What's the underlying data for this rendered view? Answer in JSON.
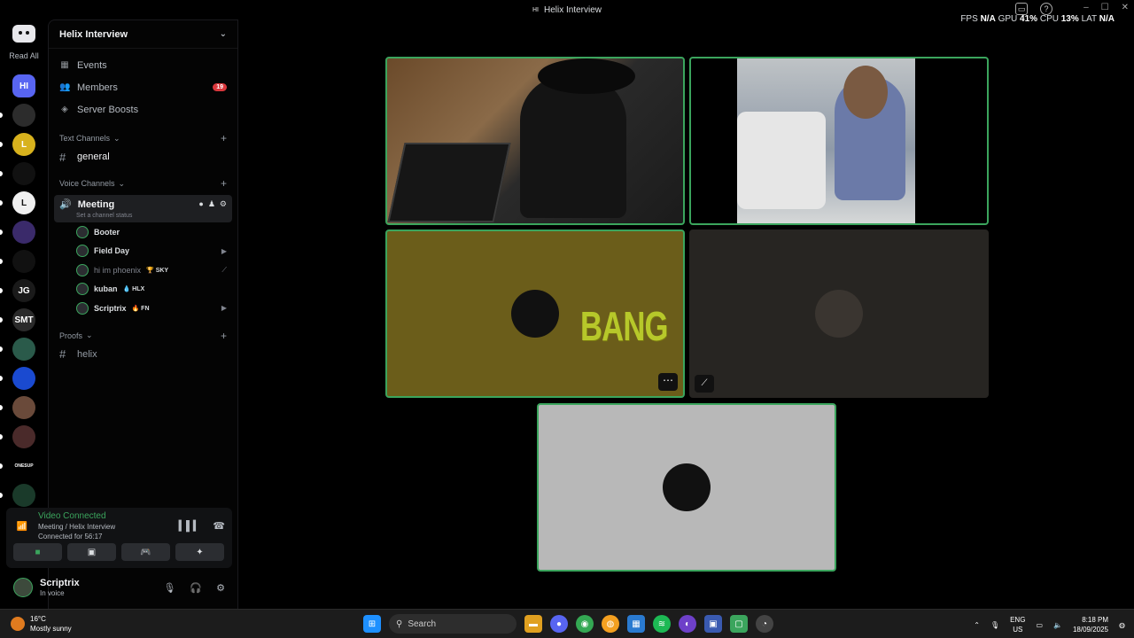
{
  "window": {
    "title": "Helix Interview",
    "title_badge": "HI",
    "controls": [
      "–",
      "☐",
      "✕"
    ]
  },
  "perf": {
    "fps_label": "FPS",
    "fps": "N/A",
    "gpu_label": "GPU",
    "gpu": "41",
    "cpu_label": "CPU",
    "cpu": "13",
    "lat_label": "LAT",
    "lat": "N/A",
    "pct": "%"
  },
  "rail": {
    "read_all": "Read All",
    "servers": [
      {
        "label": "HI",
        "color": "#5865f2"
      },
      {
        "label": "",
        "color": "#2c2c2c"
      },
      {
        "label": "L",
        "color": "#d8b21d"
      },
      {
        "label": "",
        "color": "#111111"
      },
      {
        "label": "L",
        "color": "#f0f0f0"
      },
      {
        "label": "",
        "color": "#3a2a6a"
      },
      {
        "label": "",
        "color": "#111111"
      },
      {
        "label": "JG",
        "color": "#1a1a1a"
      },
      {
        "label": "SMT",
        "color": "#2a2a2a"
      },
      {
        "label": "",
        "color": "#2a5a4a"
      },
      {
        "label": "",
        "color": "#1a4ad0"
      },
      {
        "label": "",
        "color": "#6a4a3a"
      },
      {
        "label": "",
        "color": "#4a2a2a"
      },
      {
        "label": "ONESUP",
        "color": "#000000"
      },
      {
        "label": "",
        "color": "#1a3a2a"
      }
    ]
  },
  "panel": {
    "server_name": "Helix Interview",
    "nav": [
      {
        "label": "Events",
        "icon": "calendar-icon",
        "glyph": "▦"
      },
      {
        "label": "Members",
        "icon": "members-icon",
        "glyph": "👥",
        "badge": "19"
      },
      {
        "label": "Server Boosts",
        "icon": "boost-icon",
        "glyph": "◈"
      }
    ],
    "text_category": "Text Channels",
    "text_channels": [
      "general"
    ],
    "voice_category": "Voice Channels",
    "voice_channel": "Meeting",
    "voice_status": "Set a channel status",
    "voice_users": [
      {
        "name": "Booter",
        "tag": "",
        "dim": false,
        "end": ""
      },
      {
        "name": "Field Day",
        "tag": "",
        "dim": false,
        "end": "▶"
      },
      {
        "name": "hi im phoenix",
        "tag": "🏆 SKY",
        "dim": true,
        "end": "⟋"
      },
      {
        "name": "kuban",
        "tag": "💧 HLX",
        "dim": false,
        "end": ""
      },
      {
        "name": "Scriptrix",
        "tag": "🔥 FN",
        "dim": false,
        "end": "▶"
      }
    ],
    "proofs_category": "Proofs",
    "proofs_channels": [
      "helix"
    ]
  },
  "vconn": {
    "title": "Video Connected",
    "location": "Meeting / Helix Interview",
    "duration": "Connected for 56:17"
  },
  "user": {
    "name": "Scriptrix",
    "status": "In voice"
  },
  "tiles": {
    "bang_text": "BANG",
    "more_glyph": "⋯",
    "mute_glyph": "⟋"
  },
  "taskbar": {
    "temp": "16°C",
    "condition": "Mostly sunny",
    "search": "Search",
    "lang1": "ENG",
    "lang2": "US",
    "time": "8:18 PM",
    "date": "18/09/2025"
  }
}
